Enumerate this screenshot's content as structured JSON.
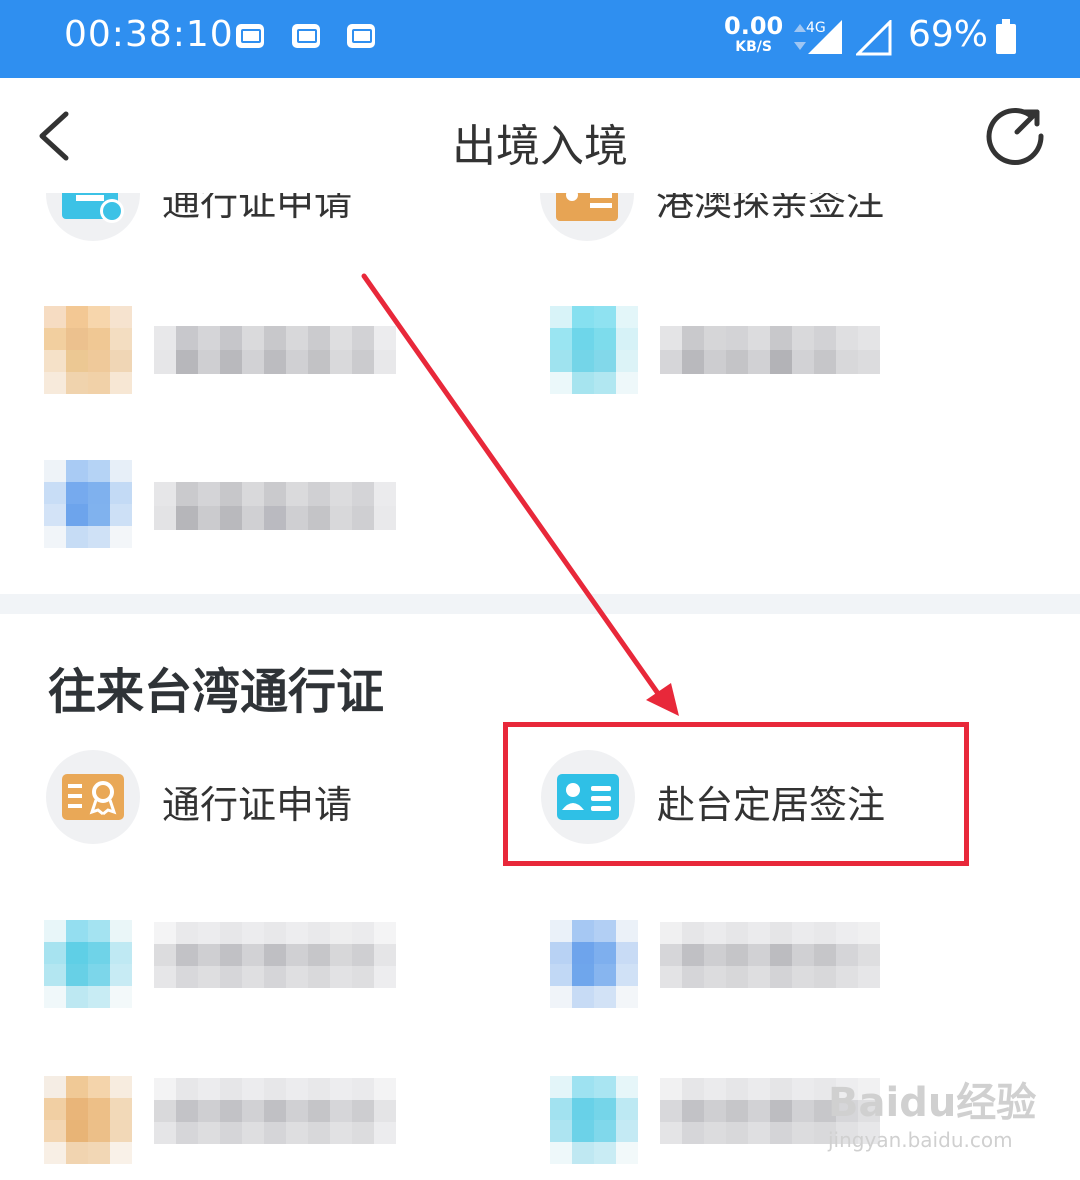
{
  "status_bar": {
    "time": "00:38:10",
    "net_speed_value": "0.00",
    "net_speed_unit": "KB/S",
    "network_type": "4G",
    "battery_percent": "69%"
  },
  "header": {
    "title": "出境入境"
  },
  "top_section": {
    "items": [
      {
        "label": "通行证申请"
      },
      {
        "label": "港澳探亲签注"
      }
    ]
  },
  "taiwan_section": {
    "title": "往来台湾通行证",
    "items": [
      {
        "label": "通行证申请"
      },
      {
        "label": "赴台定居签注"
      }
    ]
  },
  "watermark": {
    "brand": "Baidu经验",
    "site": "jingyan.baidu.com"
  },
  "colors": {
    "status_bar": "#2f8ff0",
    "highlight": "#e8283a",
    "orange_icon": "#e9a857",
    "cyan_icon": "#2fc0e6"
  },
  "icons": [
    "back-arrow-icon",
    "refresh-icon",
    "mail-icon",
    "signal-icon",
    "battery-icon",
    "certificate-icon",
    "id-card-icon"
  ]
}
